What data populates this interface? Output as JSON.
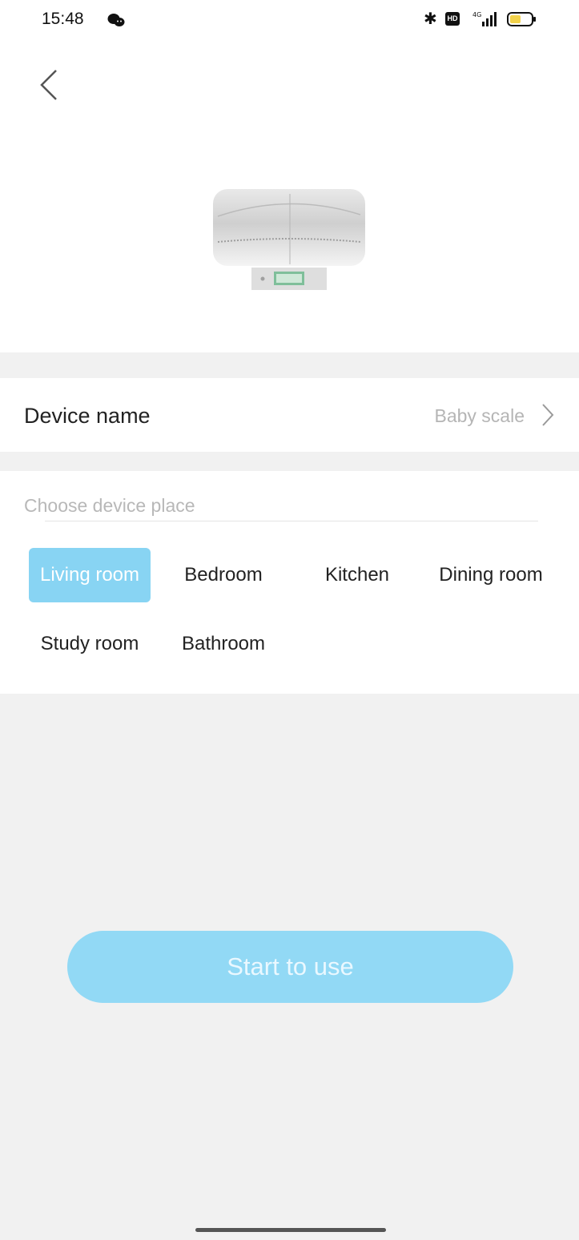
{
  "status_bar": {
    "time": "15:48",
    "wechat_icon": "wechat-icon",
    "bluetooth_icon": "bluetooth-icon",
    "hd_icon": "HD",
    "signal_icon": "signal-4g-icon",
    "battery_icon": "battery-icon",
    "battery_color": "#f2d24b"
  },
  "header": {
    "back_icon": "chevron-left-icon"
  },
  "device": {
    "image": "baby-scale-image",
    "name_label": "Device name",
    "name_value": "Baby scale",
    "name_chevron": "chevron-right-icon"
  },
  "place": {
    "title": "Choose device place",
    "options": [
      {
        "label": "Living room",
        "selected": true
      },
      {
        "label": "Bedroom",
        "selected": false
      },
      {
        "label": "Kitchen",
        "selected": false
      },
      {
        "label": "Dining room",
        "selected": false
      },
      {
        "label": "Study room",
        "selected": false
      },
      {
        "label": "Bathroom",
        "selected": false
      }
    ]
  },
  "actions": {
    "start_label": "Start to use"
  },
  "colors": {
    "accent": "#88d4f3",
    "button": "#92d9f5",
    "background": "#f1f1f1"
  }
}
